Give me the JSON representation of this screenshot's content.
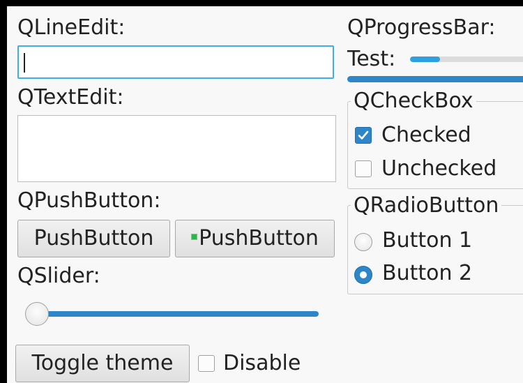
{
  "labels": {
    "lineedit": "QLineEdit:",
    "textedit": "QTextEdit:",
    "pushbutton": "QPushButton:",
    "slider": "QSlider:",
    "progressbar": "QProgressBar:",
    "progress_test": "Test:"
  },
  "lineedit": {
    "value": ""
  },
  "textedit": {
    "value": ""
  },
  "pushbuttons": [
    {
      "label": "PushButton"
    },
    {
      "label": "PushButton",
      "icon": "small-green-icon"
    }
  ],
  "slider": {
    "value": 0,
    "min": 0,
    "max": 100
  },
  "progress": {
    "small_value": 25,
    "big_value": 100
  },
  "checkbox_group": {
    "title": "QCheckBox",
    "items": [
      {
        "label": "Checked",
        "checked": true
      },
      {
        "label": "Unchecked",
        "checked": false
      }
    ]
  },
  "radio_group": {
    "title": "QRadioButton",
    "items": [
      {
        "label": "Button 1",
        "checked": false
      },
      {
        "label": "Button 2",
        "checked": true
      }
    ]
  },
  "footer": {
    "toggle_label": "Toggle theme",
    "disable_label": "Disable",
    "disable_checked": false
  },
  "colors": {
    "accent": "#2e86c8",
    "focus": "#3daee9",
    "window_bg": "#f8f8f8"
  }
}
